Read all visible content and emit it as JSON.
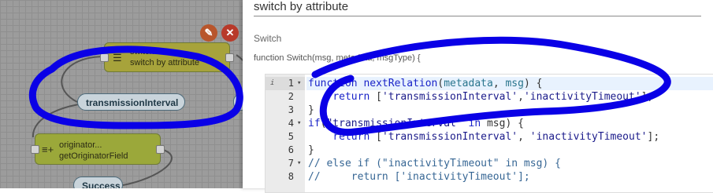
{
  "canvas": {
    "switch_node": {
      "type": "switch",
      "name": "switch by attribute",
      "icon": "filter-icon"
    },
    "field_node": {
      "type": "originator...",
      "name": "getOriginatorField",
      "icon": "add-list-icon"
    },
    "relation_labels": [
      "transmissionInterval",
      "Success"
    ],
    "edit_icon": "pencil-icon",
    "close_icon": "close-icon"
  },
  "panel": {
    "name_value": "switch by attribute",
    "section_label": "Switch",
    "signature": "function Switch(msg, metadata, msgType) {",
    "code": [
      {
        "n": "1",
        "fold": "▾",
        "info": "i",
        "active": true,
        "tokens": [
          [
            "kw",
            "function "
          ],
          [
            "fn",
            "nextRelation"
          ],
          [
            "",
            "("
          ],
          [
            "prm",
            "metadata"
          ],
          [
            "",
            ", "
          ],
          [
            "prm",
            "msg"
          ],
          [
            "",
            ") {"
          ]
        ]
      },
      {
        "n": "2",
        "tokens": [
          [
            "",
            "    "
          ],
          [
            "kw",
            "return "
          ],
          [
            "",
            "["
          ],
          [
            "str",
            "'transmissionInterval'"
          ],
          [
            "",
            ","
          ],
          [
            "str",
            "'inactivityTimeout'"
          ],
          [
            "",
            "];"
          ]
        ]
      },
      {
        "n": "3",
        "tokens": [
          [
            "",
            "}"
          ]
        ]
      },
      {
        "n": "4",
        "fold": "▾",
        "tokens": [
          [
            "kw",
            "if"
          ],
          [
            "",
            "("
          ],
          [
            "str",
            "\"transmissionInterval\""
          ],
          [
            "kw",
            " in "
          ],
          [
            "",
            "msg) {"
          ]
        ]
      },
      {
        "n": "5",
        "tokens": [
          [
            "",
            "    "
          ],
          [
            "kw",
            "return "
          ],
          [
            "",
            "["
          ],
          [
            "str",
            "'transmissionInterval'"
          ],
          [
            "",
            ", "
          ],
          [
            "str",
            "'inactivityTimeout'"
          ],
          [
            "",
            "];"
          ]
        ]
      },
      {
        "n": "6",
        "tokens": [
          [
            "",
            "}"
          ]
        ]
      },
      {
        "n": "7",
        "fold": "▾",
        "tokens": [
          [
            "cm",
            "// else if (\"inactivityTimeout\" in msg) {"
          ]
        ]
      },
      {
        "n": "8",
        "tokens": [
          [
            "cm",
            "//     return ['inactivityTimeout'];"
          ]
        ]
      }
    ]
  },
  "colors": {
    "annotation": "#0a00e6",
    "keyword": "#1a24c8",
    "switch_node": "#a7a33b",
    "field_node": "#9ba83a"
  }
}
